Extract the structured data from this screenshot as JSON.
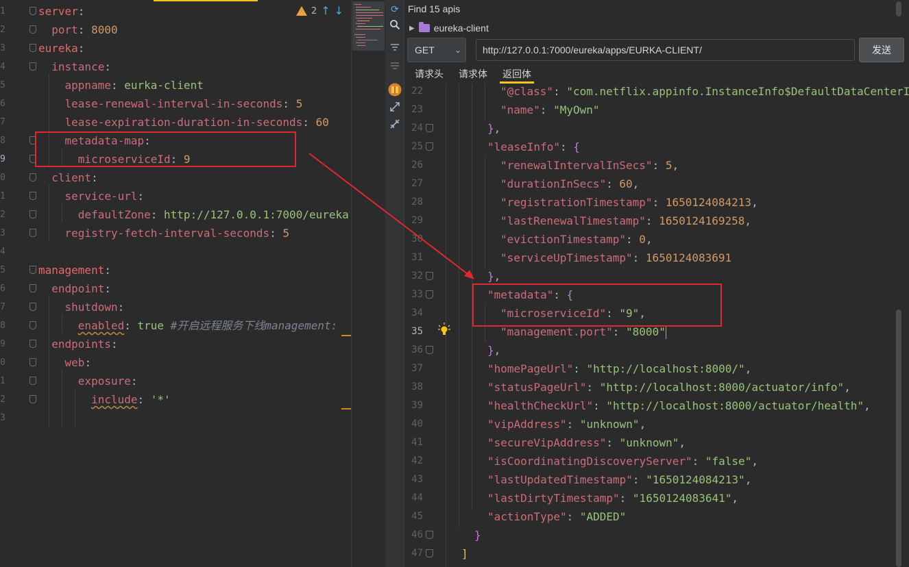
{
  "left_editor": {
    "line_numbers": [
      "1",
      "2",
      "3",
      "4",
      "5",
      "6",
      "7",
      "8",
      "9",
      "0",
      "1",
      "2",
      "3",
      "4",
      "5",
      "6",
      "7",
      "8",
      "9",
      "0",
      "1",
      "2",
      "3"
    ],
    "warnings_count": "2",
    "lines": {
      "l1_key": "server",
      "l2_key": "port",
      "l2_val": "8000",
      "l3_key": "eureka",
      "l4_key": "instance",
      "l5_key": "appname",
      "l5_val": "eurka-client",
      "l6_key": "lease-renewal-interval-in-seconds",
      "l6_val": "5",
      "l7_key": "lease-expiration-duration-in-seconds",
      "l7_val": "60",
      "l8_key": "metadata-map",
      "l9_key": "microserviceId",
      "l9_val": "9",
      "l10_key": "client",
      "l11_key": "service-url",
      "l12_key": "defaultZone",
      "l12_val": "http://127.0.0.1:7000/eureka",
      "l13_key": "registry-fetch-interval-seconds",
      "l13_val": "5",
      "l15_key": "management",
      "l16_key": "endpoint",
      "l17_key": "shutdown",
      "l18_key": "enabled",
      "l18_val": "true",
      "l18_comment": "#开启远程服务下线management:",
      "l19_key": "endpoints",
      "l20_key": "web",
      "l21_key": "exposure",
      "l22_key": "include",
      "l22_val": "'*'"
    }
  },
  "right_panel": {
    "find_text": "Find 15 apis",
    "tree_item": "eureka-client",
    "method": "GET",
    "url": "http://127.0.0.1:7000/eureka/apps/EURKA-CLIENT/",
    "send_label": "发送",
    "tabs": [
      "请求头",
      "请求体",
      "返回体"
    ],
    "active_tab": "返回体",
    "response_line_numbers": [
      "22",
      "23",
      "24",
      "25",
      "26",
      "27",
      "28",
      "29",
      "30",
      "31",
      "32",
      "33",
      "34",
      "35",
      "36",
      "37",
      "38",
      "39",
      "40",
      "41",
      "42",
      "43",
      "44",
      "45",
      "46",
      "47"
    ],
    "response": {
      "r22_k": "\"@class\"",
      "r22_v": "\"com.netflix.appinfo.InstanceInfo$DefaultDataCenterI",
      "r23_k": "\"name\"",
      "r23_v": "\"MyOwn\"",
      "r25_k": "\"leaseInfo\"",
      "r26_k": "\"renewalIntervalInSecs\"",
      "r26_v": "5",
      "r27_k": "\"durationInSecs\"",
      "r27_v": "60",
      "r28_k": "\"registrationTimestamp\"",
      "r28_v": "1650124084213",
      "r29_k": "\"lastRenewalTimestamp\"",
      "r29_v": "1650124169258",
      "r30_k": "\"evictionTimestamp\"",
      "r30_v": "0",
      "r31_k": "\"serviceUpTimestamp\"",
      "r31_v": "1650124083691",
      "r33_k": "\"metadata\"",
      "r34_k": "\"microserviceId\"",
      "r34_v": "\"9\"",
      "r35_k": "\"management.port\"",
      "r35_v": "\"8000\"",
      "r37_k": "\"homePageUrl\"",
      "r37_v": "\"http://localhost:8000/\"",
      "r38_k": "\"statusPageUrl\"",
      "r38_v": "\"http://localhost:8000/actuator/info\"",
      "r39_k": "\"healthCheckUrl\"",
      "r39_v": "\"http://localhost:8000/actuator/health\"",
      "r40_k": "\"vipAddress\"",
      "r40_v": "\"unknown\"",
      "r41_k": "\"secureVipAddress\"",
      "r41_v": "\"unknown\"",
      "r42_k": "\"isCoordinatingDiscoveryServer\"",
      "r42_v": "\"false\"",
      "r43_k": "\"lastUpdatedTimestamp\"",
      "r43_v": "\"1650124084213\"",
      "r44_k": "\"lastDirtyTimestamp\"",
      "r44_v": "\"1650124083641\"",
      "r45_k": "\"actionType\"",
      "r45_v": "\"ADDED\""
    }
  },
  "colors": {
    "annotation_red": "#e0282e",
    "yaml_key": "#cc6c7c",
    "string_green": "#98c379",
    "number_orange": "#d19a66",
    "active_tab_yellow": "#f5c518"
  },
  "icons": [
    "warning-icon",
    "arrow-up-icon",
    "arrow-down-icon",
    "refresh-icon",
    "search-icon",
    "filter-icon",
    "collapse-icon",
    "book-icon",
    "expand-icon",
    "compress-icon",
    "folder-icon",
    "lightbulb-icon"
  ]
}
